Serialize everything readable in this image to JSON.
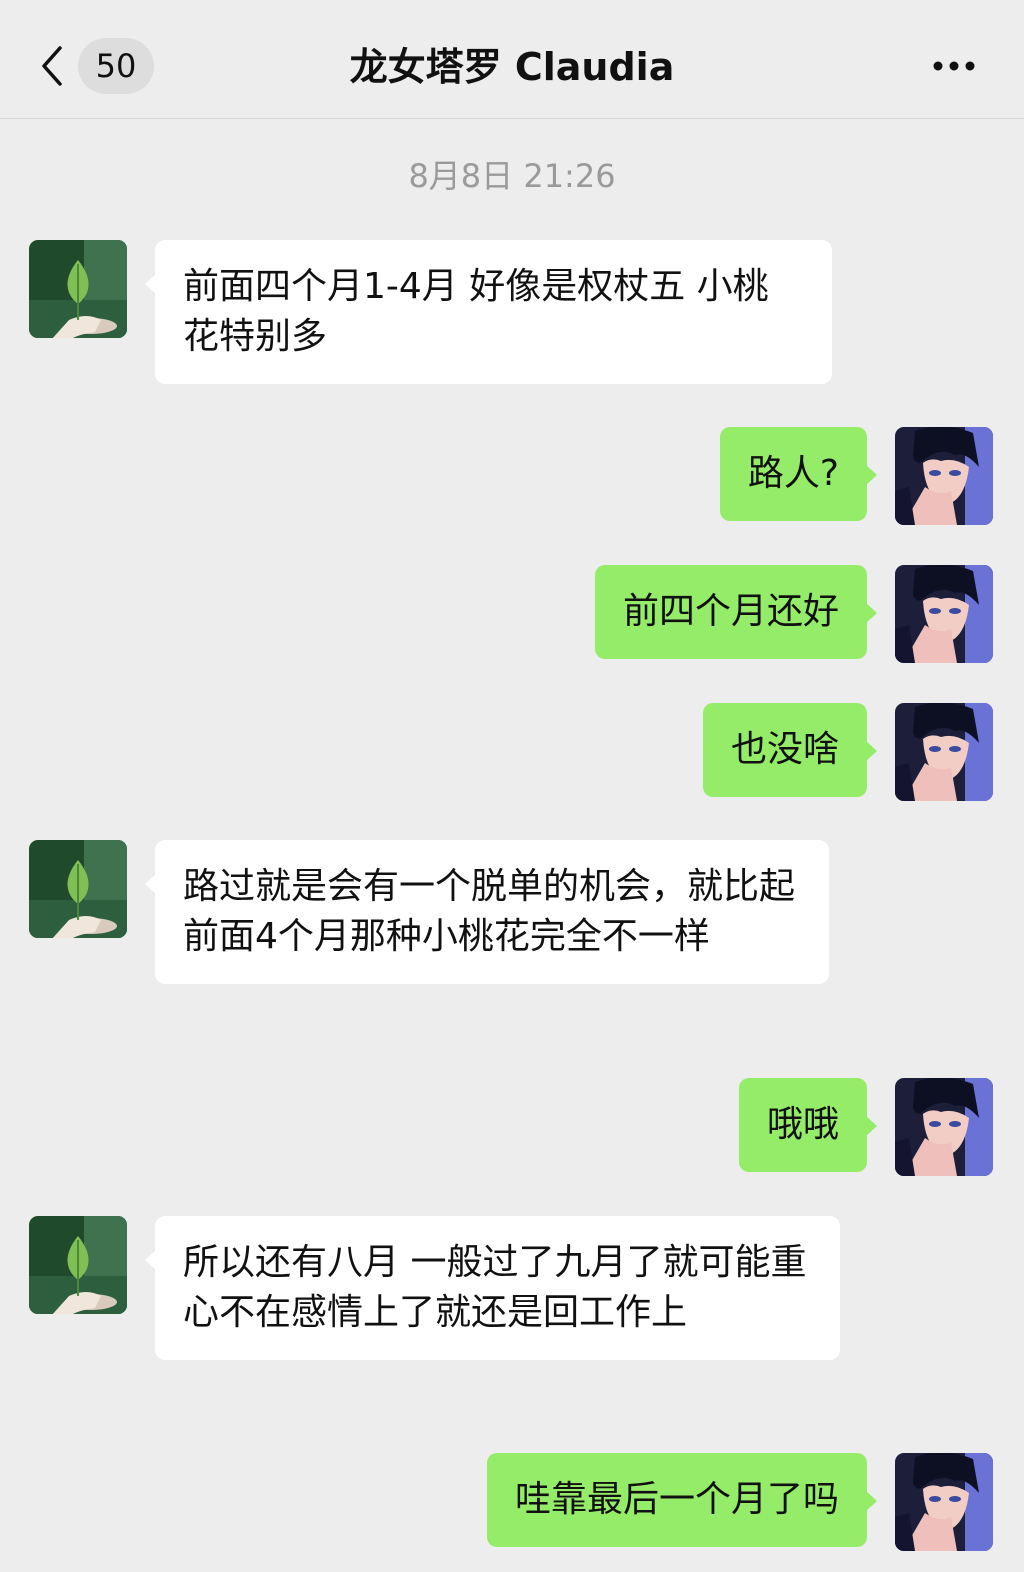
{
  "header": {
    "unread_count": "50",
    "title": "龙女塔罗 Claudia"
  },
  "timestamp": "8月8日 21:26",
  "messages": [
    {
      "side": "in",
      "text": "前面四个月1-4月 好像是权杖五 小桃花特别多"
    },
    {
      "side": "out",
      "text": "路人?"
    },
    {
      "side": "out",
      "text": "前四个月还好"
    },
    {
      "side": "out",
      "text": "也没啥"
    },
    {
      "side": "in",
      "text": "路过就是会有一个脱单的机会，就比起前面4个月那种小桃花完全不一样"
    },
    {
      "side": "out",
      "text": "哦哦"
    },
    {
      "side": "in",
      "text": "所以还有八月 一般过了九月了就可能重心不在感情上了就还是回工作上"
    },
    {
      "side": "out",
      "text": "哇靠最后一个月了吗"
    }
  ],
  "icons": {
    "back": "chevron-left-icon",
    "more": "ellipsis-icon",
    "contact_avatar": "leaf-in-hand-avatar",
    "self_avatar": "anime-boy-avatar"
  },
  "colors": {
    "background": "#ededed",
    "incoming_bubble": "#ffffff",
    "outgoing_bubble": "#95ec69",
    "timestamp_text": "#9a9a9a"
  }
}
